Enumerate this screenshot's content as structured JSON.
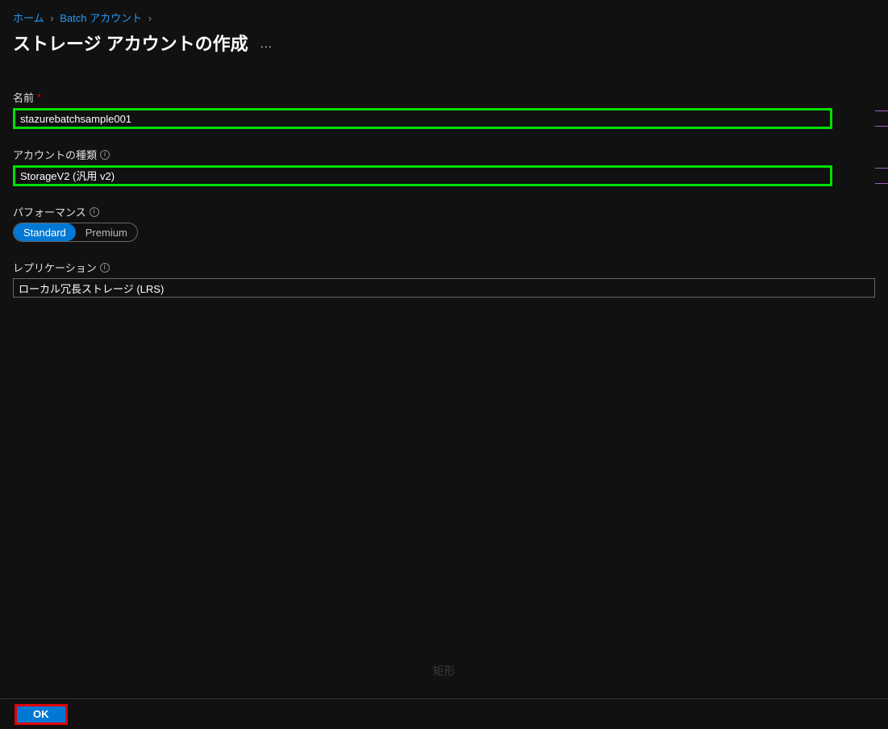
{
  "breadcrumb": {
    "home": "ホーム",
    "batch": "Batch アカウント"
  },
  "page": {
    "title": "ストレージ アカウントの作成",
    "more": "…"
  },
  "form": {
    "name": {
      "label": "名前",
      "required": "*",
      "value": "stazurebatchsample001"
    },
    "account_type": {
      "label": "アカウントの種類",
      "value": "StorageV2 (汎用 v2)"
    },
    "performance": {
      "label": "パフォーマンス",
      "options": {
        "standard": "Standard",
        "premium": "Premium"
      },
      "selected": "standard"
    },
    "replication": {
      "label": "レプリケーション",
      "value": "ローカル冗長ストレージ (LRS)"
    }
  },
  "watermark": "矩形",
  "footer": {
    "ok": "OK"
  },
  "colors": {
    "highlight_green": "#00e000",
    "highlight_red": "#e00000",
    "azure_blue": "#0078d4",
    "link_blue": "#2899f5"
  }
}
